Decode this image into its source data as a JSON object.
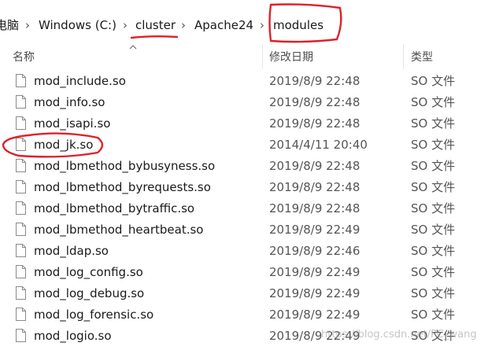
{
  "breadcrumb": {
    "items": [
      {
        "label": "电脑"
      },
      {
        "label": "Windows (C:)"
      },
      {
        "label": "cluster"
      },
      {
        "label": "Apache24"
      },
      {
        "label": "modules"
      }
    ],
    "separator": "›"
  },
  "columns": {
    "name": "名称",
    "date": "修改日期",
    "type": "类型"
  },
  "files": [
    {
      "name": "mod_include.so",
      "date": "2019/8/9 22:48",
      "type": "SO 文件"
    },
    {
      "name": "mod_info.so",
      "date": "2019/8/9 22:48",
      "type": "SO 文件"
    },
    {
      "name": "mod_isapi.so",
      "date": "2019/8/9 22:48",
      "type": "SO 文件"
    },
    {
      "name": "mod_jk.so",
      "date": "2014/4/11 20:40",
      "type": "SO 文件"
    },
    {
      "name": "mod_lbmethod_bybusyness.so",
      "date": "2019/8/9 22:48",
      "type": "SO 文件"
    },
    {
      "name": "mod_lbmethod_byrequests.so",
      "date": "2019/8/9 22:48",
      "type": "SO 文件"
    },
    {
      "name": "mod_lbmethod_bytraffic.so",
      "date": "2019/8/9 22:48",
      "type": "SO 文件"
    },
    {
      "name": "mod_lbmethod_heartbeat.so",
      "date": "2019/8/9 22:49",
      "type": "SO 文件"
    },
    {
      "name": "mod_ldap.so",
      "date": "2019/8/9 22:46",
      "type": "SO 文件"
    },
    {
      "name": "mod_log_config.so",
      "date": "2019/8/9 22:49",
      "type": "SO 文件"
    },
    {
      "name": "mod_log_debug.so",
      "date": "2019/8/9 22:49",
      "type": "SO 文件"
    },
    {
      "name": "mod_log_forensic.so",
      "date": "2019/8/9 22:49",
      "type": "SO 文件"
    },
    {
      "name": "mod_logio.so",
      "date": "2019/8/9 22:49",
      "type": "SO 文件"
    }
  ],
  "watermark": "https://blog.csdn.net/PC_wang",
  "colors": {
    "annotation": "#e0202a",
    "text": "#1a1a1a",
    "muted": "#555555"
  },
  "icons": {
    "file": "file-icon",
    "sort": "chevron-up-icon"
  }
}
